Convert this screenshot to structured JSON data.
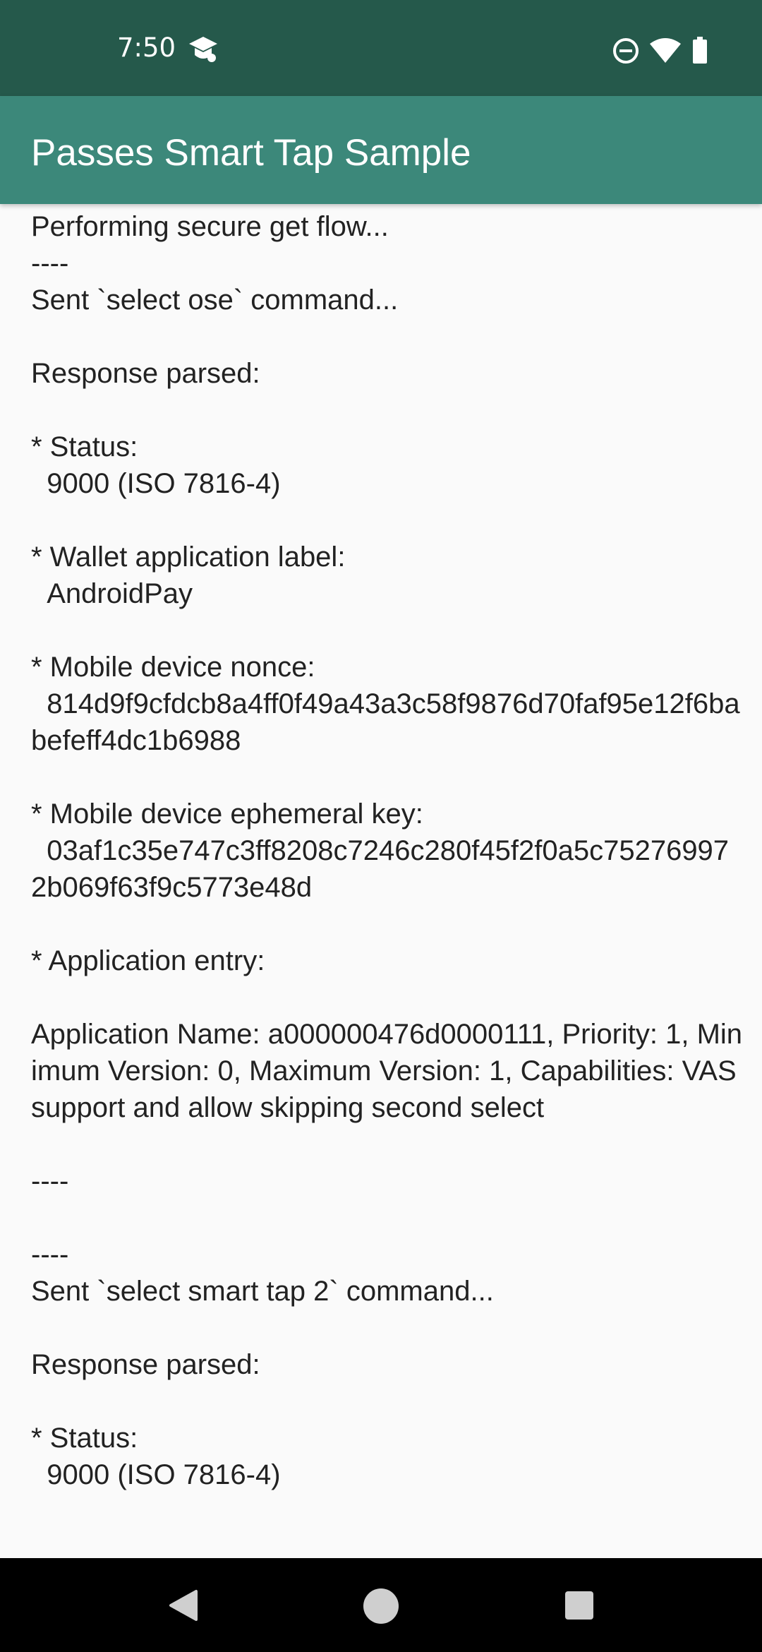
{
  "status_bar": {
    "time": "7:50",
    "icons": [
      "app-notification-icon",
      "do-not-disturb-icon",
      "wifi-icon",
      "battery-icon"
    ]
  },
  "app_bar": {
    "title": "Passes Smart Tap Sample"
  },
  "log": {
    "text": "Performing secure get flow...\n----\nSent `select ose` command...\n\nResponse parsed:\n\n* Status:\n  9000 (ISO 7816-4)\n\n* Wallet application label:\n  AndroidPay\n\n* Mobile device nonce:\n  814d9f9cfdcb8a4ff0f49a43a3c58f9876d70faf95e12f6babefeff4dc1b6988\n\n* Mobile device ephemeral key:\n  03af1c35e747c3ff8208c7246c280f45f2f0a5c752769972b069f63f9c5773e48d\n\n* Application entry:\n\nApplication Name: a000000476d0000111, Priority: 1, Minimum Version: 0, Maximum Version: 1, Capabilities: VAS support and allow skipping second select\n\n----\n\n----\nSent `select smart tap 2` command...\n\nResponse parsed:\n\n* Status:\n  9000 (ISO 7816-4)"
  },
  "nav_bar": {
    "icons": [
      "back-icon",
      "home-icon",
      "recents-icon"
    ]
  },
  "colors": {
    "status_bar": "#25594b",
    "app_bar": "#3c887a",
    "background": "#fafafa",
    "text": "#222222"
  }
}
